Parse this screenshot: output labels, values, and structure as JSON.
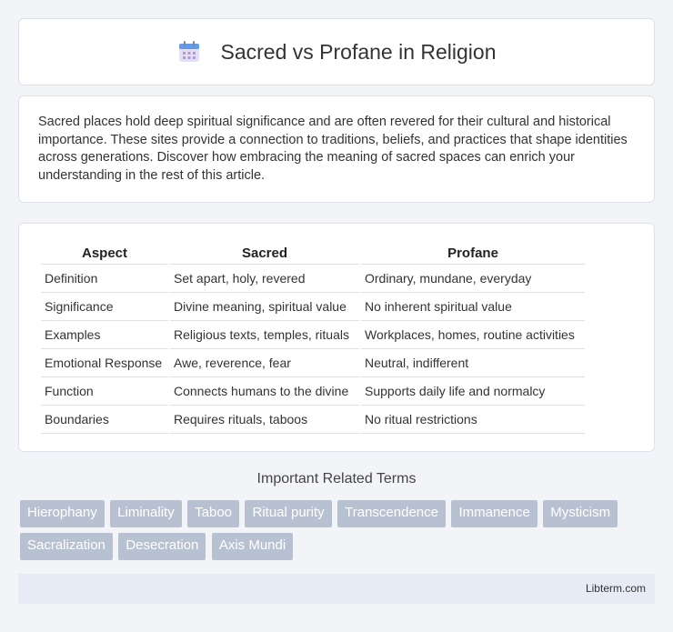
{
  "header": {
    "title": "Sacred vs Profane in Religion",
    "icon": "calendar-icon"
  },
  "intro": {
    "text": "Sacred places hold deep spiritual significance and are often revered for their cultural and historical importance. These sites provide a connection to traditions, beliefs, and practices that shape identities across generations. Discover how embracing the meaning of sacred spaces can enrich your understanding in the rest of this article."
  },
  "table": {
    "headers": [
      "Aspect",
      "Sacred",
      "Profane"
    ],
    "rows": [
      [
        "Definition",
        "Set apart, holy, revered",
        "Ordinary, mundane, everyday"
      ],
      [
        "Significance",
        "Divine meaning, spiritual value",
        "No inherent spiritual value"
      ],
      [
        "Examples",
        "Religious texts, temples, rituals",
        "Workplaces, homes, routine activities"
      ],
      [
        "Emotional Response",
        "Awe, reverence, fear",
        "Neutral, indifferent"
      ],
      [
        "Function",
        "Connects humans to the divine",
        "Supports daily life and normalcy"
      ],
      [
        "Boundaries",
        "Requires rituals, taboos",
        "No ritual restrictions"
      ]
    ]
  },
  "related": {
    "title": "Important Related Terms",
    "tags": [
      "Hierophany",
      "Liminality",
      "Taboo",
      "Ritual purity",
      "Transcendence",
      "Immanence",
      "Mysticism",
      "Sacralization",
      "Desecration",
      "Axis Mundi"
    ]
  },
  "footer": {
    "text": "Libterm.com"
  },
  "colors": {
    "tag_bg": "#b8c1d1",
    "page_bg": "#f3f4f8",
    "footer_bg": "#e6ebf5"
  }
}
